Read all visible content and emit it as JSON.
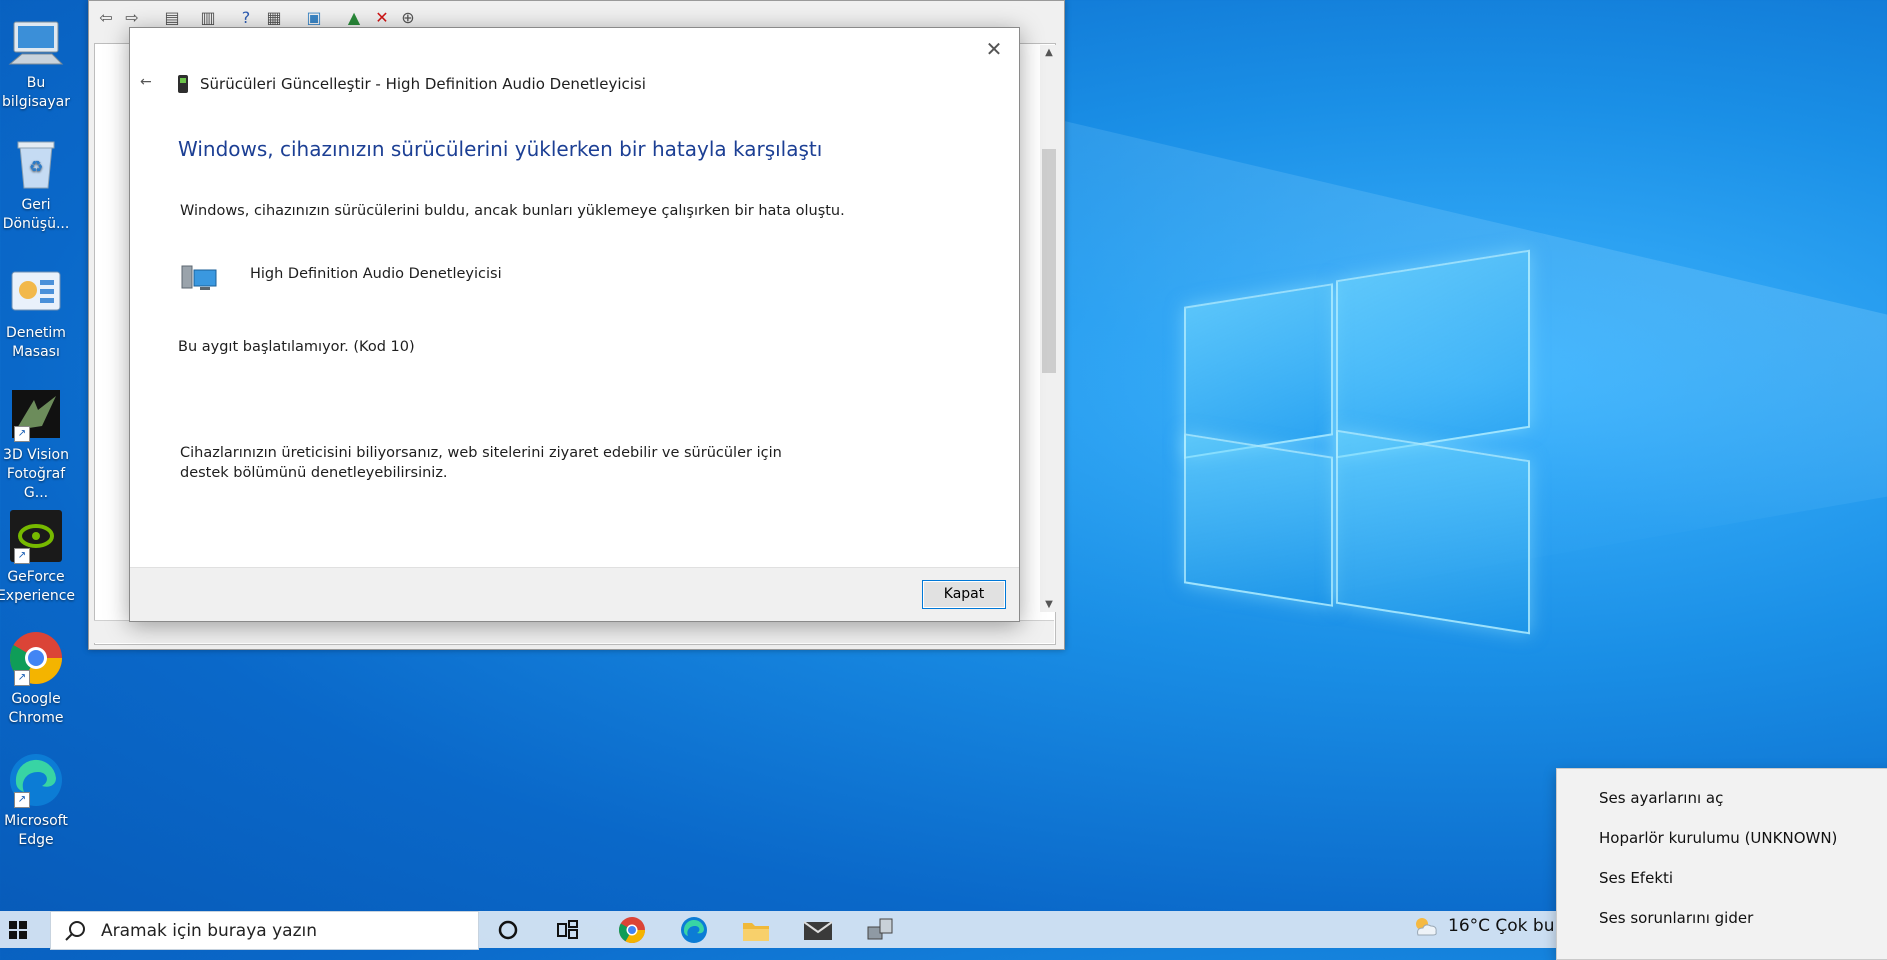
{
  "desktop": {
    "icons": [
      {
        "label": "Bu bilgisayar",
        "icon": "computer-icon"
      },
      {
        "label": "Geri Dönüşü...",
        "icon": "recycle-bin-icon"
      },
      {
        "label": "Denetim Masası",
        "icon": "control-panel-icon"
      },
      {
        "label": "3D Vision Fotoğraf G...",
        "icon": "3d-vision-icon"
      },
      {
        "label": "GeForce Experience",
        "icon": "nvidia-icon"
      },
      {
        "label": "Google Chrome",
        "icon": "chrome-icon"
      },
      {
        "label": "Microsoft Edge",
        "icon": "edge-icon"
      }
    ]
  },
  "dialog": {
    "title": "Sürücüleri Güncelleştir - High Definition Audio Denetleyicisi",
    "heading": "Windows, cihazınızın sürücülerini yüklerken bir hatayla karşılaştı",
    "message": "Windows, cihazınızın sürücülerini buldu, ancak bunları yüklemeye çalışırken bir hata oluştu.",
    "device_name": "High Definition Audio Denetleyicisi",
    "error_code": "Bu aygıt başlatılamıyor. (Kod 10)",
    "help_text": "Cihazlarınızın üreticisini biliyorsanız, web sitelerini ziyaret edebilir ve sürücüler için destek bölümünü denetleyebilirsiniz.",
    "close_button": "Kapat"
  },
  "taskbar": {
    "search_placeholder": "Aramak için buraya yazın",
    "weather": "16°C  Çok bu",
    "apps": [
      "cortana-icon",
      "task-view-icon",
      "chrome-icon",
      "edge-icon",
      "file-explorer-icon",
      "mail-icon",
      "device-manager-icon"
    ]
  },
  "context_menu": {
    "items": [
      "Ses ayarlarını aç",
      "Hoparlör kurulumu (UNKNOWN)",
      "Ses Efekti",
      "Ses sorunlarını gider"
    ]
  },
  "colors": {
    "heading_blue": "#1c3f94",
    "accent": "#0078d7",
    "desktop": "#0a68c9"
  }
}
